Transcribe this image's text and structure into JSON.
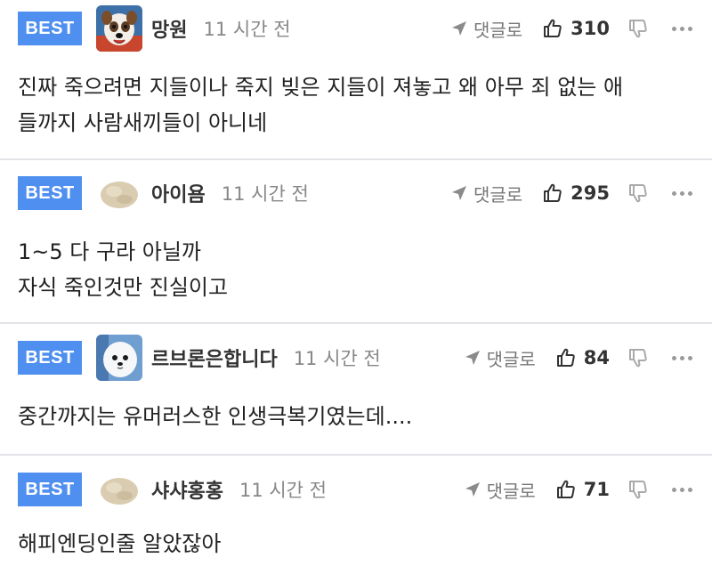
{
  "colors": {
    "best_badge": "#4f8ff0",
    "divider": "#e2e4e8",
    "meta_gray": "#888888"
  },
  "comments": [
    {
      "badge": "BEST",
      "nickname": "망원",
      "time": "11 시간 전",
      "reply_label": "댓글로",
      "likes": "310",
      "avatar": "dog-avatar",
      "lines": [
        "진짜 죽으려면 지들이나 죽지 빚은 지들이 져놓고 왜 아무 죄 없는 애",
        "들까지 사람새끼들이 아니네"
      ]
    },
    {
      "badge": "BEST",
      "nickname": "아이욤",
      "time": "11 시간 전",
      "reply_label": "댓글로",
      "likes": "295",
      "avatar": "default-avatar",
      "lines": [
        "1~5 다 구라 아닐까",
        "자식 죽인것만 진실이고"
      ]
    },
    {
      "badge": "BEST",
      "nickname": "르브론은합니다",
      "time": "11 시간 전",
      "reply_label": "댓글로",
      "likes": "84",
      "avatar": "seal-avatar",
      "lines": [
        "중간까지는 유머러스한 인생극복기였는데...."
      ]
    },
    {
      "badge": "BEST",
      "nickname": "샤샤홍홍",
      "time": "11 시간 전",
      "reply_label": "댓글로",
      "likes": "71",
      "avatar": "default-avatar",
      "lines": [
        "해피엔딩인줄 알았잖아"
      ]
    }
  ]
}
